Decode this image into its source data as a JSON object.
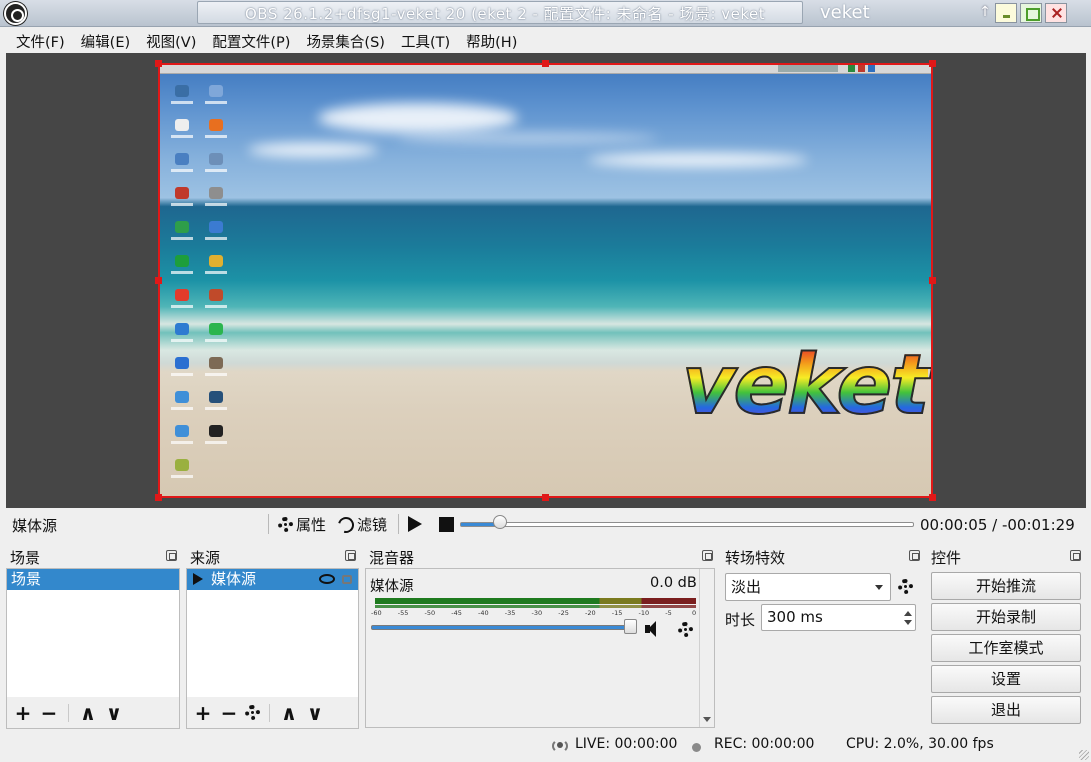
{
  "window": {
    "title": "OBS 26.1.2+dfsg1-veket 20 (eket 2 - 配置文件: 未命名 - 场景: veket",
    "brand": "veket",
    "pin_glyph": "↑"
  },
  "menu": [
    {
      "label": "文件(F)"
    },
    {
      "label": "编辑(E)"
    },
    {
      "label": "视图(V)"
    },
    {
      "label": "配置文件(P)"
    },
    {
      "label": "场景集合(S)"
    },
    {
      "label": "工具(T)"
    },
    {
      "label": "帮助(H)"
    }
  ],
  "preview": {
    "wallpaper_logo": "veket",
    "selection_color": "#e01818"
  },
  "mediabar": {
    "source_name": "媒体源",
    "properties_label": "属性",
    "filters_label": "滤镜",
    "progress": 0.05,
    "time": "00:00:05 / -00:01:29"
  },
  "docks": {
    "scenes": {
      "title": "场景",
      "items": [
        "场景"
      ]
    },
    "sources": {
      "title": "来源",
      "items": [
        "媒体源"
      ]
    },
    "mixer": {
      "title": "混音器",
      "channel": "媒体源",
      "level": "0.0 dB",
      "scale": [
        "-60",
        "-55",
        "-50",
        "-45",
        "-40",
        "-35",
        "-30",
        "-25",
        "-20",
        "-15",
        "-10",
        "-5",
        "0"
      ],
      "volume": 1.0
    },
    "transitions": {
      "title": "转场特效",
      "selected": "淡出",
      "duration_label": "时长",
      "duration_value": "300 ms"
    },
    "controls": {
      "title": "控件",
      "buttons": [
        "开始推流",
        "开始录制",
        "工作室模式",
        "设置",
        "退出"
      ]
    }
  },
  "statusbar": {
    "live": "LIVE: 00:00:00",
    "rec": "REC: 00:00:00",
    "cpu": "CPU: 2.0%, 30.00 fps"
  },
  "colors": {
    "selection": "#3388cc",
    "accent": "#3a8ad6"
  }
}
